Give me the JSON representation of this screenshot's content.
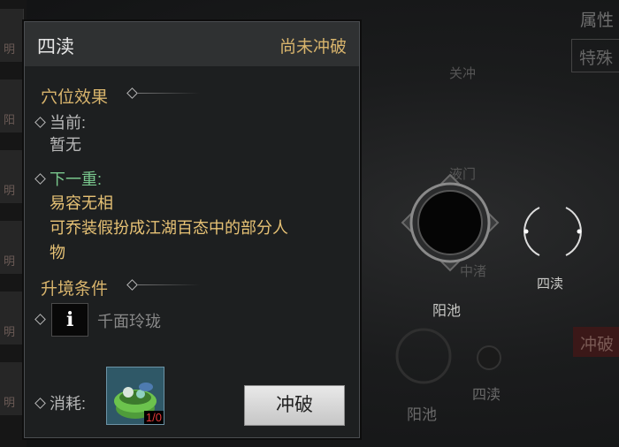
{
  "panel": {
    "title": "四渎",
    "status": "尚未冲破",
    "effect_title": "穴位效果",
    "current_label": "当前:",
    "current_value": "暂无",
    "next_label": "下一重:",
    "next_name": "易容无相",
    "next_desc_1": "可乔装假扮成江湖百态中的部分人",
    "next_desc_2": "物",
    "cond_title": "升境条件",
    "cond_icon": "i",
    "cond_text": "千面玲珑",
    "cost_label": "消耗:",
    "item_count": "1/0",
    "break_button": "冲破"
  },
  "background": {
    "attr_title": "属性",
    "attr_box": "特殊",
    "guanchong": "关冲",
    "yemen": "液门",
    "zhongzhu": "中渚",
    "yangchi_big": "阳池",
    "sidu_small": "四渎",
    "yangchi_faint": "阳池",
    "sidu_faint": "四渎",
    "red_box": "冲破",
    "left_strip": [
      "明",
      "阳",
      "明",
      "明",
      "明",
      "明"
    ]
  },
  "colors": {
    "accent_gold": "#d8b46c",
    "green": "#79c78d",
    "count_red": "#e53a3a"
  }
}
